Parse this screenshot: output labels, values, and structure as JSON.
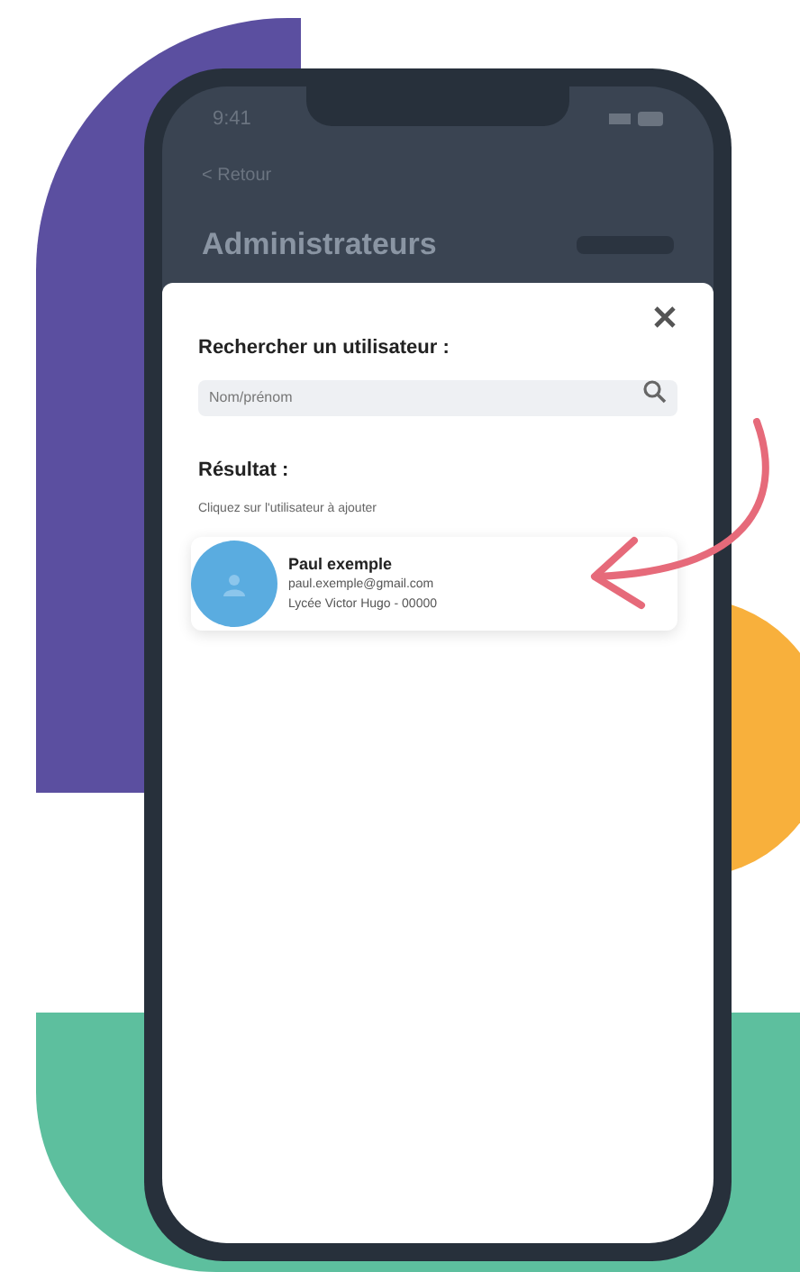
{
  "status_bar": {
    "time": "9:41"
  },
  "header": {
    "back": "< Retour",
    "title": "Administrateurs"
  },
  "modal": {
    "search_label": "Rechercher un utilisateur :",
    "search": {
      "placeholder": "Nom/prénom"
    },
    "results_title": "Résultat :",
    "results_hint": "Cliquez sur l'utilisateur à ajouter",
    "results": [
      {
        "name": "Paul exemple",
        "email": "paul.exemple@gmail.com",
        "school": "Lycée Victor Hugo - 00000"
      }
    ]
  }
}
